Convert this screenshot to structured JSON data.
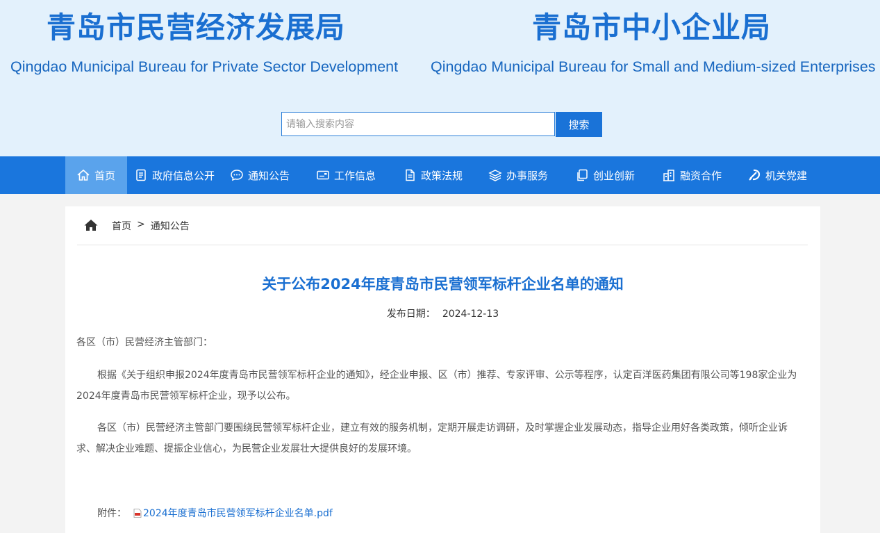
{
  "header": {
    "left_title_cn": "青岛市民营经济发展局",
    "left_title_en": "Qingdao Municipal Bureau for Private Sector Development",
    "right_title_cn": "青岛市中小企业局",
    "right_title_en": "Qingdao Municipal Bureau for Small and Medium-sized Enterprises"
  },
  "search": {
    "placeholder": "请输入搜索内容",
    "button_label": "搜索"
  },
  "nav": {
    "items": [
      {
        "label": "首页",
        "icon": "home-icon"
      },
      {
        "label": "政府信息公开",
        "icon": "document-icon"
      },
      {
        "label": "通知公告",
        "icon": "chat-icon"
      },
      {
        "label": "工作信息",
        "icon": "card-icon"
      },
      {
        "label": "政策法规",
        "icon": "file-icon"
      },
      {
        "label": "办事服务",
        "icon": "layers-icon"
      },
      {
        "label": "创业创新",
        "icon": "copy-icon"
      },
      {
        "label": "融资合作",
        "icon": "building-icon"
      },
      {
        "label": "机关党建",
        "icon": "party-emblem-icon"
      }
    ],
    "active_color": "#5aa3ec",
    "bar_color": "#1a76dd"
  },
  "breadcrumb": {
    "home": "首页",
    "separator": ">",
    "current": "通知公告"
  },
  "article": {
    "title": "关于公布2024年度青岛市民营领军标杆企业名单的通知",
    "date_label": "发布日期：",
    "date_value": "2024-12-13",
    "greeting": "各区（市）民营经济主管部门：",
    "para1": "根据《关于组织申报2024年度青岛市民营领军标杆企业的通知》，经企业申报、区（市）推荐、专家评审、公示等程序，认定百洋医药集团有限公司等198家企业为2024年度青岛市民营领军标杆企业，现予以公布。",
    "para2": "各区（市）民营经济主管部门要围绕民营领军标杆企业，建立有效的服务机制，定期开展走访调研，及时掌握企业发展动态，指导企业用好各类政策，倾听企业诉求、解决企业难题、提振企业信心，为民营企业发展壮大提供良好的发展环境。",
    "attachment_label": "附件：",
    "attachment_name": "2024年度青岛市民营领军标杆企业名单.pdf"
  },
  "colors": {
    "brand_blue": "#1a6fd1",
    "header_bg": "#e3f1fc"
  }
}
